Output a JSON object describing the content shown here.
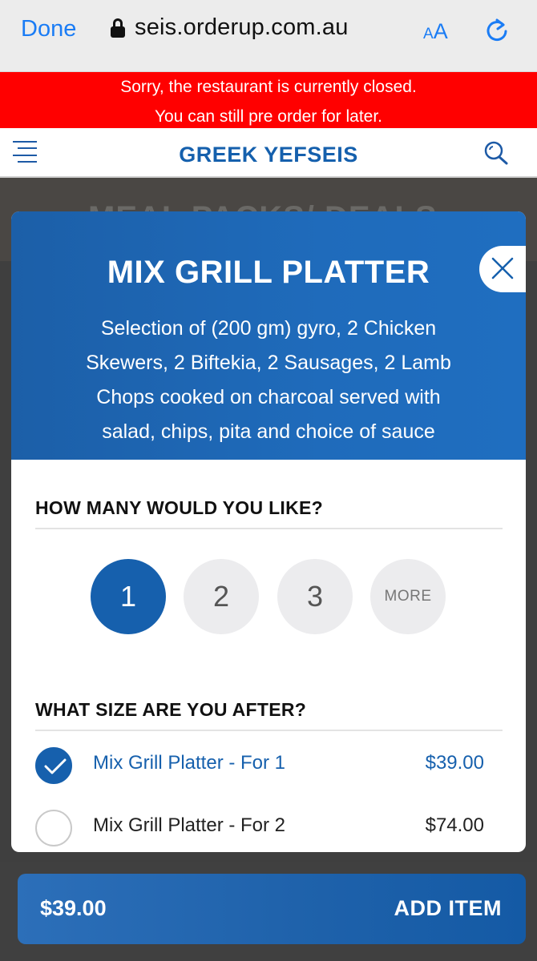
{
  "browser": {
    "done_label": "Done",
    "url": "seis.orderup.com.au",
    "text_size_label_small": "A",
    "text_size_label_large": "A",
    "icons": [
      "lock-icon",
      "reload-icon"
    ]
  },
  "banner": {
    "line1": "Sorry, the restaurant is currently closed.",
    "line2": "You can still pre order for later.",
    "color": "#ff0000"
  },
  "header": {
    "brand": "GREEK YEFSEIS",
    "icons": [
      "menu-icon",
      "search-icon"
    ]
  },
  "background": {
    "hero_text": "MEAL PACKS/ DEALS"
  },
  "item": {
    "title": "MIX GRILL PLATTER",
    "description": "Selection of (200 gm) gyro, 2 Chicken Skewers, 2 Biftekia, 2 Sausages, 2 Lamb Chops cooked on charcoal served with salad, chips, pita and choice of sauce"
  },
  "quantity": {
    "heading": "HOW MANY WOULD YOU LIKE?",
    "options": [
      "1",
      "2",
      "3",
      "MORE"
    ],
    "selected": "1"
  },
  "size": {
    "heading": "WHAT SIZE ARE YOU AFTER?",
    "options": [
      {
        "label": "Mix Grill Platter - For 1",
        "price": "$39.00",
        "selected": true
      },
      {
        "label": "Mix Grill Platter - For 2",
        "price": "$74.00",
        "selected": false
      }
    ]
  },
  "cart": {
    "total": "$39.00",
    "add_label": "ADD ITEM"
  },
  "colors": {
    "brand_blue": "#1660ad",
    "link_blue": "#1a7cf5"
  }
}
